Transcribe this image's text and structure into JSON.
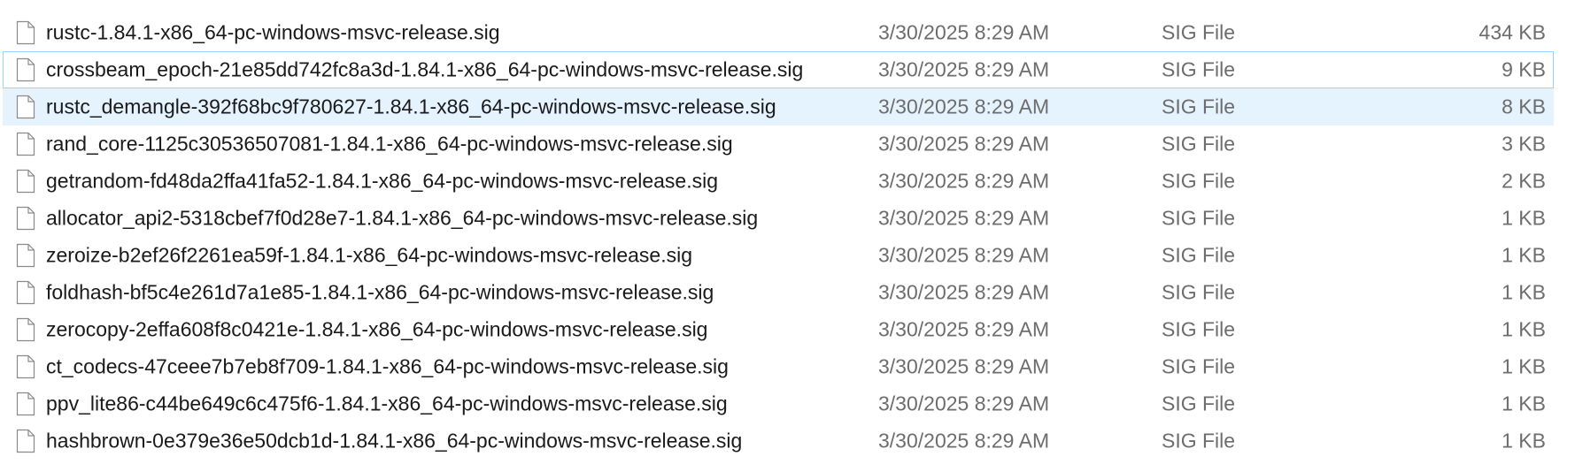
{
  "files": [
    {
      "name": "rustc-1.84.1-x86_64-pc-windows-msvc-release.sig",
      "date": "3/30/2025 8:29 AM",
      "type": "SIG File",
      "size": "434 KB",
      "icon": "file-icon"
    },
    {
      "name": "crossbeam_epoch-21e85dd742fc8a3d-1.84.1-x86_64-pc-windows-msvc-release.sig",
      "date": "3/30/2025 8:29 AM",
      "type": "SIG File",
      "size": "9 KB",
      "icon": "file-icon"
    },
    {
      "name": "rustc_demangle-392f68bc9f780627-1.84.1-x86_64-pc-windows-msvc-release.sig",
      "date": "3/30/2025 8:29 AM",
      "type": "SIG File",
      "size": "8 KB",
      "icon": "file-icon"
    },
    {
      "name": "rand_core-1125c30536507081-1.84.1-x86_64-pc-windows-msvc-release.sig",
      "date": "3/30/2025 8:29 AM",
      "type": "SIG File",
      "size": "3 KB",
      "icon": "file-icon"
    },
    {
      "name": "getrandom-fd48da2ffa41fa52-1.84.1-x86_64-pc-windows-msvc-release.sig",
      "date": "3/30/2025 8:29 AM",
      "type": "SIG File",
      "size": "2 KB",
      "icon": "file-icon"
    },
    {
      "name": "allocator_api2-5318cbef7f0d28e7-1.84.1-x86_64-pc-windows-msvc-release.sig",
      "date": "3/30/2025 8:29 AM",
      "type": "SIG File",
      "size": "1 KB",
      "icon": "file-icon"
    },
    {
      "name": "zeroize-b2ef26f2261ea59f-1.84.1-x86_64-pc-windows-msvc-release.sig",
      "date": "3/30/2025 8:29 AM",
      "type": "SIG File",
      "size": "1 KB",
      "icon": "file-icon"
    },
    {
      "name": "foldhash-bf5c4e261d7a1e85-1.84.1-x86_64-pc-windows-msvc-release.sig",
      "date": "3/30/2025 8:29 AM",
      "type": "SIG File",
      "size": "1 KB",
      "icon": "file-icon"
    },
    {
      "name": "zerocopy-2effa608f8c0421e-1.84.1-x86_64-pc-windows-msvc-release.sig",
      "date": "3/30/2025 8:29 AM",
      "type": "SIG File",
      "size": "1 KB",
      "icon": "file-icon"
    },
    {
      "name": "ct_codecs-47ceee7b7eb8f709-1.84.1-x86_64-pc-windows-msvc-release.sig",
      "date": "3/30/2025 8:29 AM",
      "type": "SIG File",
      "size": "1 KB",
      "icon": "file-icon"
    },
    {
      "name": "ppv_lite86-c44be649c6c475f6-1.84.1-x86_64-pc-windows-msvc-release.sig",
      "date": "3/30/2025 8:29 AM",
      "type": "SIG File",
      "size": "1 KB",
      "icon": "file-icon"
    },
    {
      "name": "hashbrown-0e379e36e50dcb1d-1.84.1-x86_64-pc-windows-msvc-release.sig",
      "date": "3/30/2025 8:29 AM",
      "type": "SIG File",
      "size": "1 KB",
      "icon": "file-icon"
    }
  ],
  "state": {
    "focused_row": 1,
    "hovered_row": 2
  },
  "colors": {
    "hover_bg": "#e5f3ff",
    "focus_border": "#99d1ff",
    "name_text": "#1a1a1a",
    "detail_text": "#6d6d6d"
  }
}
